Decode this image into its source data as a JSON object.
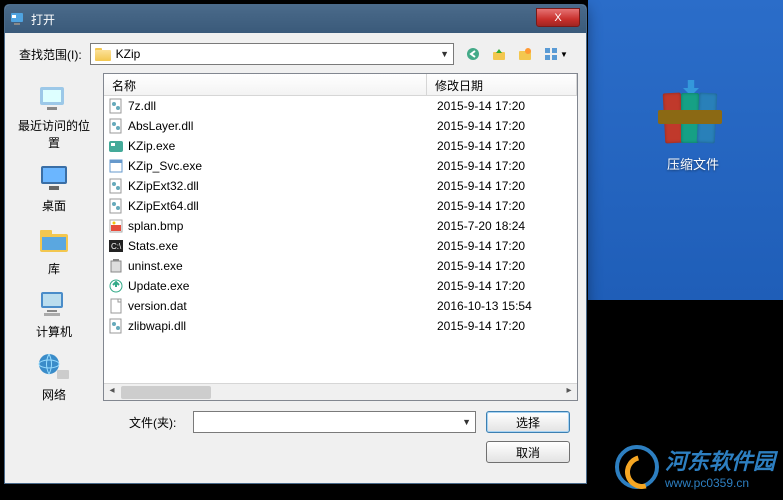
{
  "dialog": {
    "title": "打开",
    "close_x": "X"
  },
  "toolbar": {
    "look_in_label": "查找范围(I):",
    "current_folder": "KZip"
  },
  "sidebar": {
    "items": [
      {
        "label": "最近访问的位置"
      },
      {
        "label": "桌面"
      },
      {
        "label": "库"
      },
      {
        "label": "计算机"
      },
      {
        "label": "网络"
      }
    ]
  },
  "list": {
    "col_name": "名称",
    "col_date": "修改日期",
    "rows": [
      {
        "icon": "dll",
        "name": "7z.dll",
        "date": "2015-9-14 17:20"
      },
      {
        "icon": "dll",
        "name": "AbsLayer.dll",
        "date": "2015-9-14 17:20"
      },
      {
        "icon": "app",
        "name": "KZip.exe",
        "date": "2015-9-14 17:20"
      },
      {
        "icon": "exe",
        "name": "KZip_Svc.exe",
        "date": "2015-9-14 17:20"
      },
      {
        "icon": "dll",
        "name": "KZipExt32.dll",
        "date": "2015-9-14 17:20"
      },
      {
        "icon": "dll",
        "name": "KZipExt64.dll",
        "date": "2015-9-14 17:20"
      },
      {
        "icon": "bmp",
        "name": "splan.bmp",
        "date": "2015-7-20 18:24"
      },
      {
        "icon": "cmd",
        "name": "Stats.exe",
        "date": "2015-9-14 17:20"
      },
      {
        "icon": "unin",
        "name": "uninst.exe",
        "date": "2015-9-14 17:20"
      },
      {
        "icon": "upd",
        "name": "Update.exe",
        "date": "2015-9-14 17:20"
      },
      {
        "icon": "file",
        "name": "version.dat",
        "date": "2016-10-13 15:54"
      },
      {
        "icon": "dll",
        "name": "zlibwapi.dll",
        "date": "2015-9-14 17:20"
      }
    ]
  },
  "bottom": {
    "file_label": "文件(夹):",
    "file_value": "",
    "select_btn": "选择",
    "cancel_btn": "取消"
  },
  "desktop": {
    "archive_label": "压缩文件"
  },
  "watermark": {
    "name": "河东软件园",
    "url": "www.pc0359.cn"
  }
}
